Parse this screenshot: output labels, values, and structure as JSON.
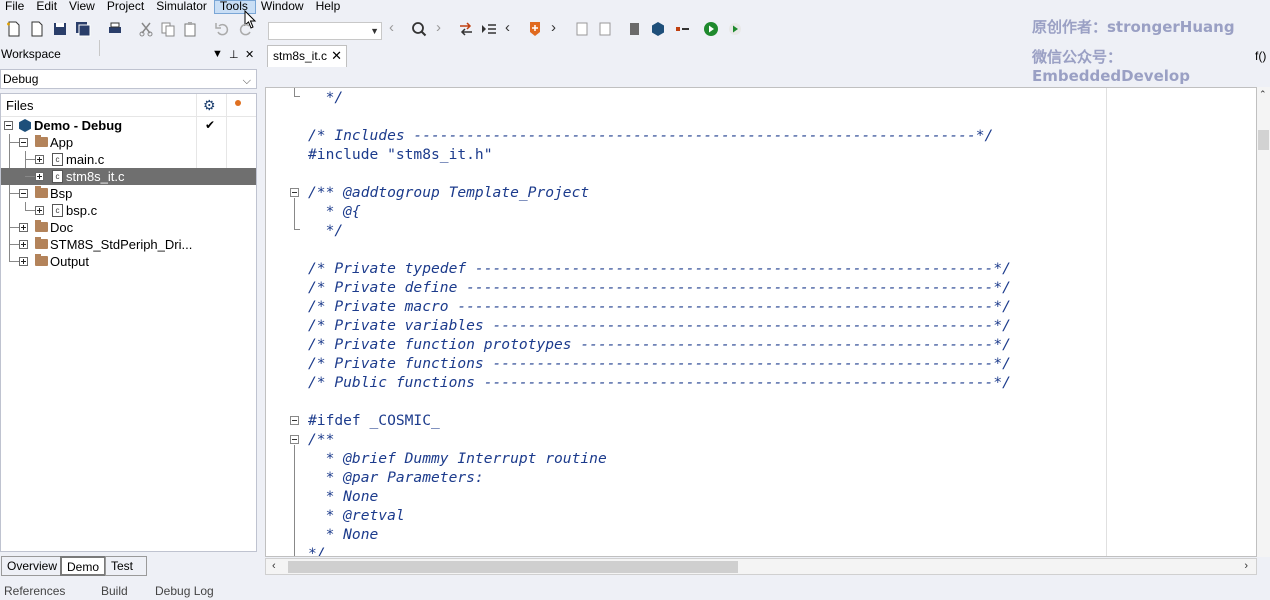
{
  "menu": [
    "File",
    "Edit",
    "View",
    "Project",
    "Simulator",
    "Tools",
    "Window",
    "Help"
  ],
  "menu_active": "Tools",
  "watermark": {
    "line1": "原创作者：strongerHuang",
    "line2": "微信公众号：EmbeddedDevelop"
  },
  "workspace": {
    "title": "Workspace",
    "config": "Debug",
    "files_label": "Files",
    "tree": {
      "project": "Demo - Debug",
      "app": "App",
      "main": "main.c",
      "stm8s_it": "stm8s_it.c",
      "bsp": "Bsp",
      "bsp_c": "bsp.c",
      "doc": "Doc",
      "stdperiph": "STM8S_StdPeriph_Dri...",
      "output": "Output"
    },
    "bottom_tabs": [
      "Overview",
      "Demo",
      "Test"
    ],
    "active_bottom_tab": "Demo"
  },
  "editor": {
    "tab": "stm8s_it.c",
    "tab_right": "f()",
    "lines": [
      "  */",
      "",
      "/* Includes ----------------------------------------------------------------*/",
      "#include \"stm8s_it.h\"",
      "",
      "/** @addtogroup Template_Project",
      "  * @{",
      "  */",
      "",
      "/* Private typedef -----------------------------------------------------------*/",
      "/* Private define ------------------------------------------------------------*/",
      "/* Private macro -------------------------------------------------------------*/",
      "/* Private variables ---------------------------------------------------------*/",
      "/* Private function prototypes -----------------------------------------------*/",
      "/* Private functions ---------------------------------------------------------*/",
      "/* Public functions ----------------------------------------------------------*/",
      "",
      "#ifdef _COSMIC_",
      "/**",
      "  * @brief Dummy Interrupt routine",
      "  * @par Parameters:",
      "  * None",
      "  * @retval",
      "  * None",
      "*/"
    ]
  },
  "status_tabs": [
    "References",
    "Build",
    "Debug Log"
  ]
}
